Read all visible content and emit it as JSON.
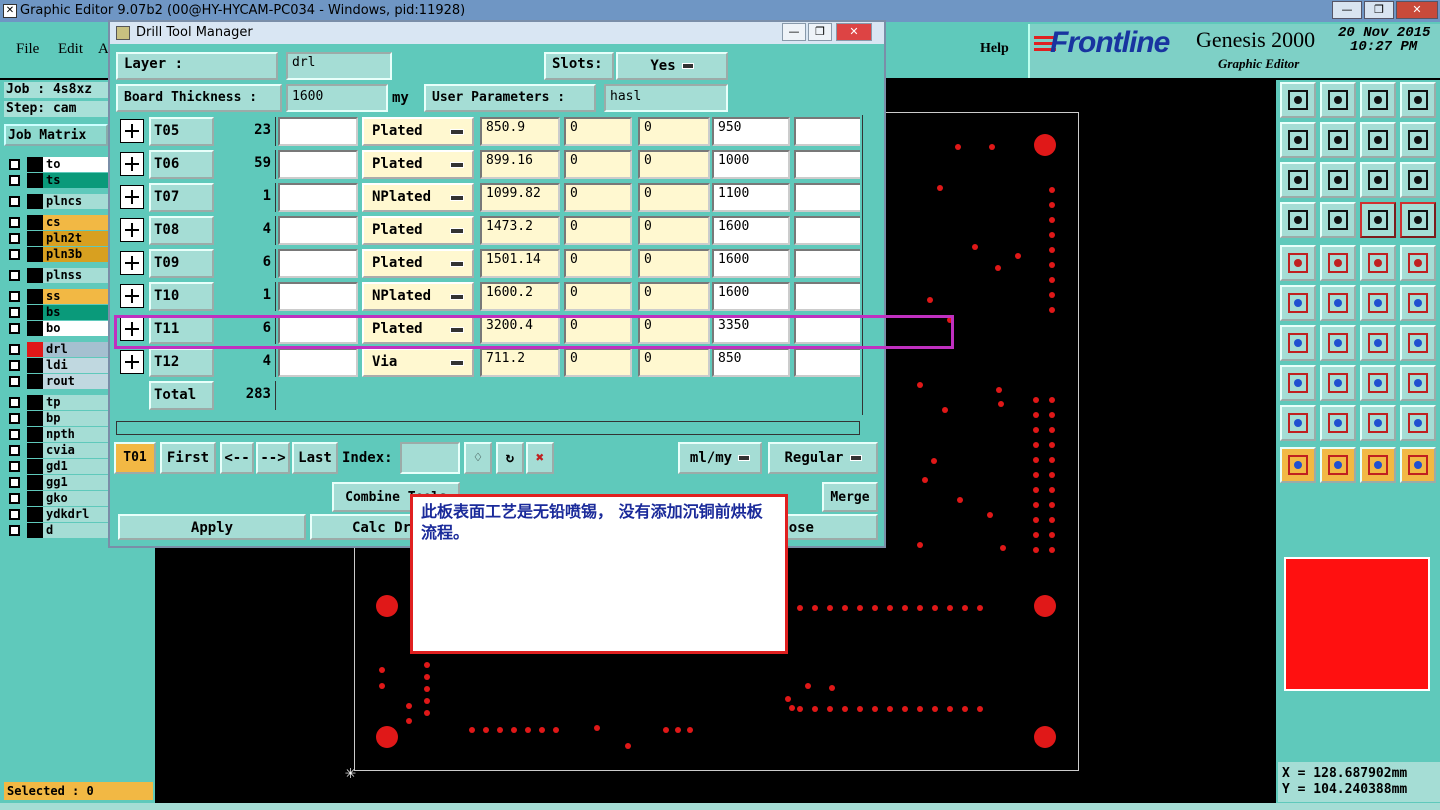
{
  "window": {
    "title": "Graphic Editor 9.07b2 (00@HY-HYCAM-PC034 - Windows, pid:11928)",
    "controls": [
      "—",
      "❐",
      "✕"
    ]
  },
  "menu": {
    "file": "File",
    "edit": "Edit",
    "a": "A",
    "help": "Help"
  },
  "brand": {
    "logo": "Frontline",
    "product": "Genesis 2000",
    "subtitle": "Graphic Editor",
    "date": "20 Nov 2015",
    "time": "10:27 PM",
    "accent": "#1834a0"
  },
  "left": {
    "job": "Job : 4s8xz",
    "step": "Step: cam",
    "job_matrix": "Job Matrix",
    "selected": "Selected : 0",
    "layers": [
      {
        "name": "to",
        "color": "#ffffff",
        "sw": "#000000"
      },
      {
        "name": "ts",
        "color": "#0a9a7a",
        "sw": "#000000"
      },
      {
        "name": "plncs",
        "color": "#a5ddd5",
        "sw": "#000000"
      },
      {
        "name": "cs",
        "color": "#f2b844",
        "sw": "#000000"
      },
      {
        "name": "pln2t",
        "color": "#d8a020",
        "sw": "#000000"
      },
      {
        "name": "pln3b",
        "color": "#d8a020",
        "sw": "#000000"
      },
      {
        "name": "plnss",
        "color": "#a5ddd5",
        "sw": "#000000"
      },
      {
        "name": "ss",
        "color": "#f2b844",
        "sw": "#000000"
      },
      {
        "name": "bs",
        "color": "#0a9a7a",
        "sw": "#000000"
      },
      {
        "name": "bo",
        "color": "#ffffff",
        "sw": "#000000"
      },
      {
        "name": "drl",
        "color": "#a5c0d0",
        "sw": "#e01818"
      },
      {
        "name": "ldi",
        "color": "#c0d8e0",
        "sw": "#000000"
      },
      {
        "name": "rout",
        "color": "#c0d8e0",
        "sw": "#000000"
      },
      {
        "name": "tp",
        "color": "#a5ddd5",
        "sw": "#000000"
      },
      {
        "name": "bp",
        "color": "#a5ddd5",
        "sw": "#000000"
      },
      {
        "name": "npth",
        "color": "#a5ddd5",
        "sw": "#000000"
      },
      {
        "name": "cvia",
        "color": "#a5ddd5",
        "sw": "#000000"
      },
      {
        "name": "gd1",
        "color": "#a5ddd5",
        "sw": "#000000"
      },
      {
        "name": "gg1",
        "color": "#a5ddd5",
        "sw": "#000000"
      },
      {
        "name": "gko",
        "color": "#a5ddd5",
        "sw": "#000000"
      },
      {
        "name": "ydkdrl",
        "color": "#a5ddd5",
        "sw": "#000000"
      },
      {
        "name": "d",
        "color": "#a5ddd5",
        "sw": "#000000"
      }
    ]
  },
  "dialog": {
    "title": "Drill Tool Manager",
    "layer_label": "Layer          :",
    "layer_value": "drl",
    "slots_label": "Slots:",
    "slots_value": "Yes",
    "thickness_label": "Board Thickness :",
    "thickness_value": "1600",
    "thickness_unit": "my",
    "user_params_label": "User Parameters :",
    "user_params_value": "hasl",
    "rows": [
      {
        "name": "T05",
        "count": "23",
        "type": "Plated",
        "v1": "850.9",
        "v2": "0",
        "v3": "0",
        "v4": "950"
      },
      {
        "name": "T06",
        "count": "59",
        "type": "Plated",
        "v1": "899.16",
        "v2": "0",
        "v3": "0",
        "v4": "1000"
      },
      {
        "name": "T07",
        "count": "1",
        "type": "NPlated",
        "v1": "1099.82",
        "v2": "0",
        "v3": "0",
        "v4": "1100"
      },
      {
        "name": "T08",
        "count": "4",
        "type": "Plated",
        "v1": "1473.2",
        "v2": "0",
        "v3": "0",
        "v4": "1600"
      },
      {
        "name": "T09",
        "count": "6",
        "type": "Plated",
        "v1": "1501.14",
        "v2": "0",
        "v3": "0",
        "v4": "1600"
      },
      {
        "name": "T10",
        "count": "1",
        "type": "NPlated",
        "v1": "1600.2",
        "v2": "0",
        "v3": "0",
        "v4": "1600"
      },
      {
        "name": "T11",
        "count": "6",
        "type": "Plated",
        "v1": "3200.4",
        "v2": "0",
        "v3": "0",
        "v4": "3350"
      },
      {
        "name": "T12",
        "count": "4",
        "type": "Via",
        "v1": "711.2",
        "v2": "0",
        "v3": "0",
        "v4": "850"
      }
    ],
    "total_label": "Total",
    "total_value": "283",
    "current_tool": "T01",
    "nav": {
      "first": "First",
      "prev": "<--",
      "next": "-->",
      "last": "Last",
      "index": "Index:"
    },
    "units": "ml/my",
    "mode": "Regular",
    "combine": "Combine Tools",
    "merge": "Merge",
    "apply": "Apply",
    "calc": "Calc Drill",
    "close": "Close"
  },
  "note": {
    "text": "此板表面工艺是无铅喷锡， 没有添加沉铜前烘板流程。"
  },
  "coords": {
    "x": "X = 128.687902mm",
    "y": "Y = 104.240388mm"
  }
}
